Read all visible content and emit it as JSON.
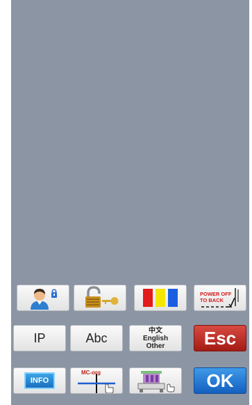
{
  "panel": {
    "colors": {
      "screen_bg": "#8c95a3",
      "esc_bg": "#c0302a",
      "ok_bg": "#2a7fd8",
      "bar_red": "#e31b1b",
      "bar_yellow": "#f5e600",
      "bar_blue": "#1b5fe0"
    }
  },
  "row1": {
    "user_icon": "user-lock-icon",
    "lock_icon": "padlock-key-icon",
    "colorbar_icon": "color-bars-icon",
    "power_off_line1": "POWER OFF",
    "power_off_line2": "TO BACK"
  },
  "row2": {
    "ip_label": "IP",
    "abc_label": "Abc",
    "lang_line1": "中文",
    "lang_line2": "English",
    "lang_line3": "Other",
    "esc_label": "Esc"
  },
  "row3": {
    "info_label": "INFO",
    "mc_org_label": "MC-org",
    "machine_icon": "embroidery-machine-icon",
    "ok_label": "OK"
  }
}
